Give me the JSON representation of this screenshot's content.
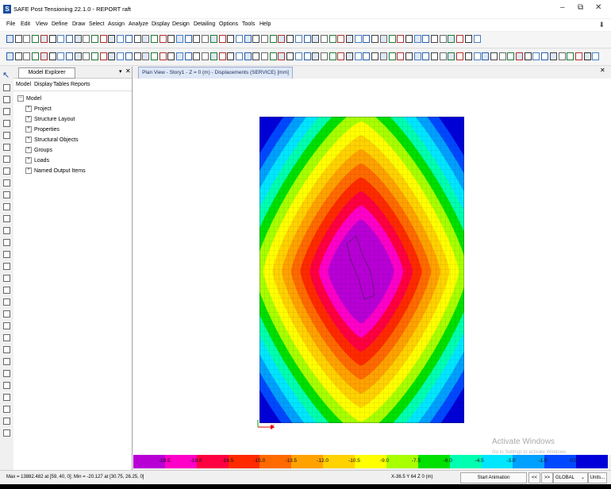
{
  "window": {
    "title": "SAFE Post Tensioning 22.1.0 - REPORT raft",
    "icon_letter": "S",
    "minimize": "–",
    "maximize": "⧉",
    "close": "✕"
  },
  "menu": [
    "File",
    "Edit",
    "View",
    "Define",
    "Draw",
    "Select",
    "Assign",
    "Analyze",
    "Display",
    "Design",
    "Detailing",
    "Options",
    "Tools",
    "Help"
  ],
  "explorer": {
    "title": "Model Explorer",
    "pin": "▾",
    "close": "✕",
    "tabs": [
      "Model",
      "Display",
      "Tables",
      "Reports"
    ],
    "root": "Model",
    "children": [
      "Project",
      "Structure Layout",
      "Properties",
      "Structural Objects",
      "Groups",
      "Loads",
      "Named Output Items"
    ]
  },
  "view": {
    "tab_title": "Plan View - Story1 - Z = 0 (m)  - Displacements (SERVICE)  [mm]",
    "close": "✕",
    "axis_x": "X"
  },
  "watermark": {
    "line1": "Activate Windows",
    "line2": "Go to Settings to activate Windows."
  },
  "legend": {
    "values": [
      "-19.5",
      "-18.0",
      "-16.5",
      "-15.0",
      "-13.5",
      "-12.0",
      "-10.5",
      "-9.0",
      "-7.5",
      "-6.0",
      "-4.5",
      "-3.0",
      "-1.5",
      "0.0"
    ],
    "colors": [
      "#b800d6",
      "#ff00c8",
      "#ff0040",
      "#ff2a00",
      "#ff6a00",
      "#ffa200",
      "#ffd200",
      "#ffff00",
      "#a8ff00",
      "#00e000",
      "#00ffb0",
      "#00e6ff",
      "#00a0ff",
      "#0048ff",
      "#0000d8"
    ]
  },
  "status": {
    "minmax": "Max = 13882.482 at [59, 40, 0];  Min = -20.127 at [30.75, 26.25, 0]",
    "coords": "X-36.5  Y 64  Z 0 (m)",
    "animation_button": "Start Animation",
    "prev": "<<",
    "next": ">>",
    "coord_system": "GLOBAL",
    "units_button": "Units..."
  },
  "colors": {
    "accent": "#1a4fa0",
    "view_tab_bg": "#dfe8f6"
  }
}
